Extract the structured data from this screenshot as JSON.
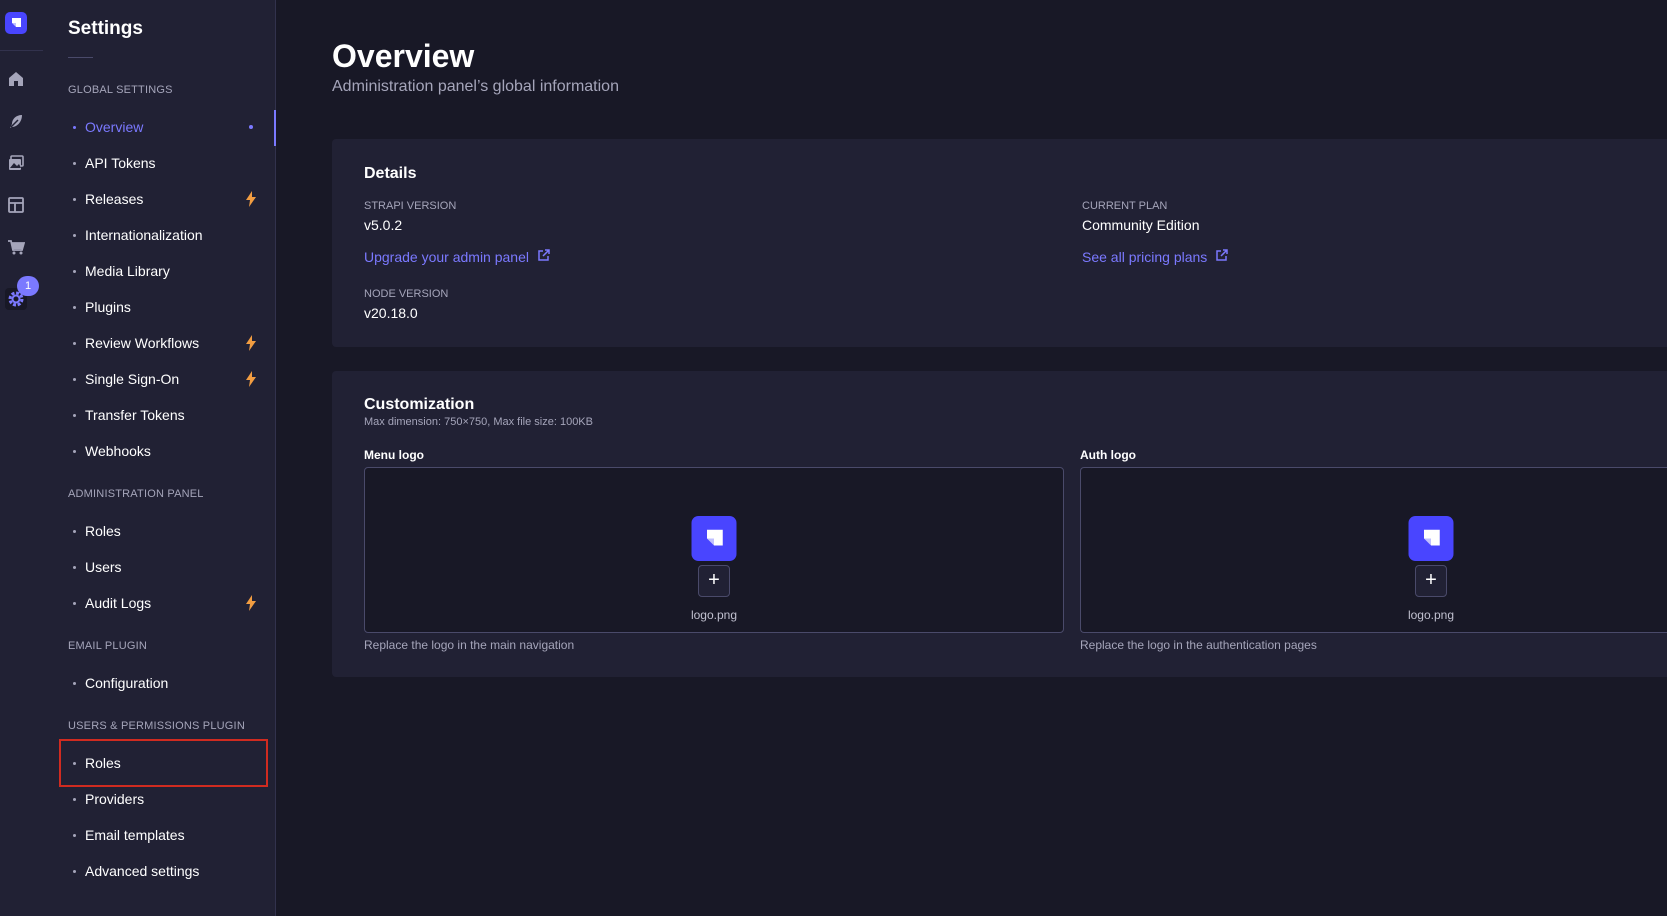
{
  "sidebar": {
    "title": "Settings",
    "sections": [
      {
        "label": "GLOBAL SETTINGS"
      },
      {
        "label": "ADMINISTRATION PANEL"
      },
      {
        "label": "EMAIL PLUGIN"
      },
      {
        "label": "USERS & PERMISSIONS PLUGIN"
      }
    ],
    "global_items": [
      {
        "label": "Overview",
        "active": true
      },
      {
        "label": "API Tokens"
      },
      {
        "label": "Releases",
        "icon": "lightning-icon"
      },
      {
        "label": "Internationalization"
      },
      {
        "label": "Media Library"
      },
      {
        "label": "Plugins"
      },
      {
        "label": "Review Workflows",
        "icon": "lightning-icon"
      },
      {
        "label": "Single Sign-On",
        "icon": "lightning-icon"
      },
      {
        "label": "Transfer Tokens"
      },
      {
        "label": "Webhooks"
      }
    ],
    "admin_items": [
      {
        "label": "Roles"
      },
      {
        "label": "Users"
      },
      {
        "label": "Audit Logs",
        "icon": "lightning-icon"
      }
    ],
    "email_items": [
      {
        "label": "Configuration"
      }
    ],
    "up_items": [
      {
        "label": "Roles"
      },
      {
        "label": "Providers"
      },
      {
        "label": "Email templates"
      },
      {
        "label": "Advanced settings"
      }
    ]
  },
  "rail": {
    "icons": [
      "strapi-logo-icon",
      "home-icon",
      "feather-icon",
      "media-icon",
      "layout-icon",
      "cart-icon",
      "gear-icon"
    ],
    "badge": "1"
  },
  "page": {
    "title": "Overview",
    "subtitle": "Administration panel’s global information"
  },
  "details": {
    "heading": "Details",
    "strapi_version_label": "STRAPI VERSION",
    "strapi_version": "v5.0.2",
    "upgrade_link": "Upgrade your admin panel",
    "current_plan_label": "CURRENT PLAN",
    "current_plan": "Community Edition",
    "pricing_link": "See all pricing plans",
    "node_version_label": "NODE VERSION",
    "node_version": "v20.18.0"
  },
  "customization": {
    "heading": "Customization",
    "subheading": "Max dimension: 750×750, Max file size: 100KB",
    "menu_logo_label": "Menu logo",
    "menu_logo_file": "logo.png",
    "menu_logo_hint": "Replace the logo in the main navigation",
    "auth_logo_label": "Auth logo",
    "auth_logo_file": "logo.png",
    "auth_logo_hint": "Replace the logo in the authentication pages"
  },
  "colors": {
    "accent": "#7b79ff",
    "brand": "#4945ff",
    "premium": "#f29d41",
    "highlight": "#d02b20"
  }
}
